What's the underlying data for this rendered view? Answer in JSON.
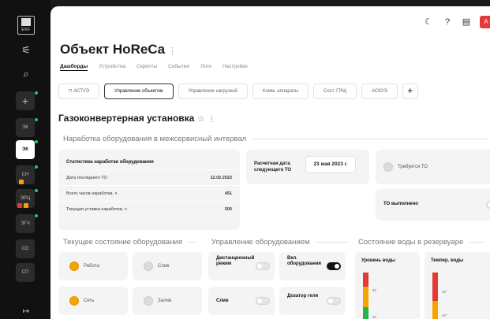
{
  "sidebar": {
    "logo_text": "EKF",
    "items": [
      {
        "label": "ЭК"
      },
      {
        "label": "ЭК"
      },
      {
        "label": "СН"
      },
      {
        "label": "ЭРЦ"
      },
      {
        "label": "ЭГЧ"
      },
      {
        "label": "СО"
      },
      {
        "label": "СП"
      }
    ]
  },
  "header": {
    "badge": "A"
  },
  "page": {
    "title": "Объект HoReCa",
    "tabs": [
      "Дашборды",
      "Устройства",
      "Скрипты",
      "События",
      "Логи",
      "Настройки"
    ],
    "subtabs": [
      "АСТУЭ",
      "Управление объектом",
      "Управление нагрузкой",
      "Комм. аппараты",
      "Сост. ГРЩ",
      "АСКУЭ"
    ],
    "subtab_plus": "+",
    "unit_title": "Газоконвертерная установка"
  },
  "sections": {
    "runtime": "Наработка оборудования в межсервисный интервал",
    "current": "Текущее состояние оборудования",
    "control": "Управление оборудованием",
    "water": "Состояние воды в резервуаре"
  },
  "stats": {
    "title": "Статистика наработки оборудования",
    "rows": [
      {
        "label": "Дата последнего ТО",
        "value": "12.02.2023"
      },
      {
        "label": "Всего часов наработки, ч",
        "value": "451"
      },
      {
        "label": "Текущая уставка наработки, ч",
        "value": "500"
      }
    ]
  },
  "next_service": {
    "label": "Расчетная дата следующего ТО",
    "date": "23 мая 2023 г."
  },
  "service_required": "Требуется ТО",
  "service_done": "ТО выполнено",
  "states": [
    {
      "label": "Работа",
      "on": true
    },
    {
      "label": "Слив",
      "on": false
    },
    {
      "label": "Сеть",
      "on": true
    },
    {
      "label": "Залив",
      "on": false
    }
  ],
  "controls": [
    {
      "label": "Дистанционный режим",
      "on": false
    },
    {
      "label": "Вкл. оборудования",
      "on": true
    },
    {
      "label": "Слив",
      "on": false
    },
    {
      "label": "Дозатор геля",
      "on": false
    }
  ],
  "water": {
    "level_label": "Уровень воды",
    "temp_label": "Темпер. воды",
    "level_ticks": [
      "60",
      "30"
    ],
    "temp_ticks": [
      "60°",
      "40°"
    ]
  }
}
